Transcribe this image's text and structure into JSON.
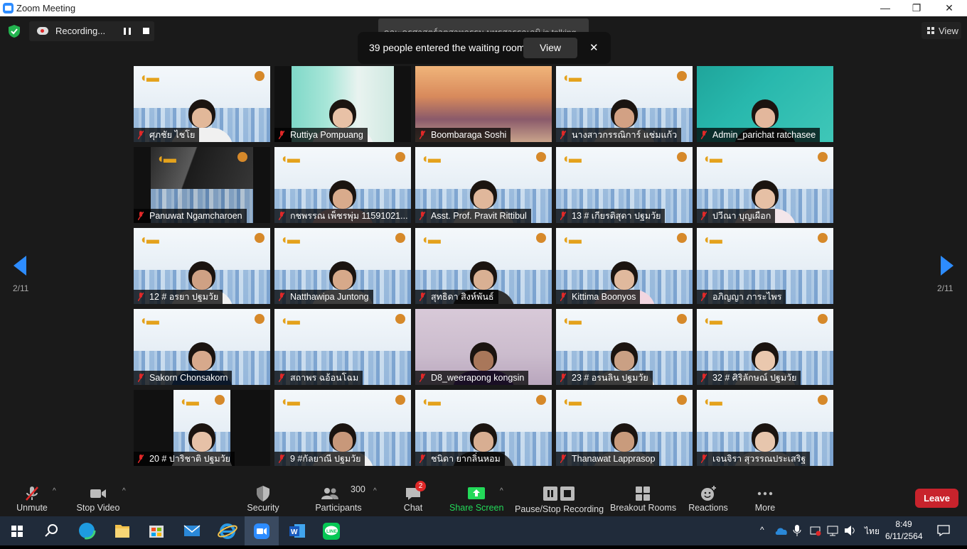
{
  "window": {
    "title": "Zoom Meeting",
    "minimize": "—",
    "maximize": "❐",
    "close": "✕"
  },
  "recording": {
    "label": "Recording..."
  },
  "talking": "คณะครุศาสตร์อุตสาหกรรม มทรสุวรรณภูมิ is talking...",
  "waiting_room": {
    "message": "39 people entered the waiting room",
    "view_label": "View",
    "close": "✕"
  },
  "view_button": "View",
  "pagination": {
    "left": "2/11",
    "right": "2/11"
  },
  "participants": [
    {
      "name": "ศุภชัย ไชโย",
      "cam": "plc",
      "person": true,
      "shirt": "#f0f0f0",
      "skin": "#e2b899"
    },
    {
      "name": "Ruttiya Pompuang",
      "cam": "room",
      "person": true,
      "shirt": "#f2f2f2",
      "skin": "#e8c1a6"
    },
    {
      "name": "Boombaraga Soshi",
      "cam": "street",
      "person": false
    },
    {
      "name": "นางสาวกรรณิการ์  แช่มแก้ว",
      "cam": "plc",
      "person": true,
      "shirt": "#e9e9e9",
      "skin": "#d2a184"
    },
    {
      "name": "Admin_parichat ratchasee",
      "cam": "symposium",
      "person": true,
      "shirt": "#2b2b2b",
      "skin": "#e3b79c"
    },
    {
      "name": "Panuwat Ngamcharoen",
      "cam": "dark",
      "person": false
    },
    {
      "name": "กชพรรณ เพ็ชรพุ่ม 11591021...",
      "cam": "plc",
      "person": true,
      "shirt": "#f5c9c9",
      "skin": "#d9ab8c"
    },
    {
      "name": "Asst. Prof. Pravit Rittibul",
      "cam": "plc",
      "person": true,
      "shirt": "#efefef",
      "skin": "#e0b79b"
    },
    {
      "name": "13 # เกียรติสุดา ปฐมวัย",
      "cam": "plc",
      "person": false
    },
    {
      "name": "ปวีณา บุญเผือก",
      "cam": "plc",
      "person": true,
      "shirt": "#f3e6ea",
      "skin": "#e6c0a5"
    },
    {
      "name": "12 # อรยา ปฐมวัย",
      "cam": "plc",
      "person": true,
      "shirt": "#f0f0f0",
      "skin": "#cfa184"
    },
    {
      "name": "Natthawipa Juntong",
      "cam": "plc",
      "person": true,
      "shirt": "#f1f1f1",
      "skin": "#d7a98a"
    },
    {
      "name": "สุทธิดา สิงห์พันธ์",
      "cam": "plc",
      "person": true,
      "shirt": "#2f2f2f",
      "skin": "#d9b093"
    },
    {
      "name": "Kittima Boonyos",
      "cam": "plc",
      "person": true,
      "shirt": "#f2d6e0",
      "skin": "#e0b99d"
    },
    {
      "name": "อภิญญา ภาระไพร",
      "cam": "plc",
      "person": false
    },
    {
      "name": "Sakorn  Chonsakorn",
      "cam": "plc",
      "person": true,
      "shirt": "#2d5fa6",
      "skin": "#d7a98c"
    },
    {
      "name": "สถาพร ฉอ้อนโฉม",
      "cam": "plc",
      "person": false
    },
    {
      "name": "D8_weerapong  kongsin",
      "cam": "wall",
      "person": true,
      "shirt": "#6a3f95",
      "skin": "#a9775a"
    },
    {
      "name": "23 # อรนลิน ปฐมวัย",
      "cam": "plc",
      "person": true,
      "shirt": "#f0f0f0",
      "skin": "#caa084"
    },
    {
      "name": "32 # ศิริลักษณ์ ปฐมวัย",
      "cam": "plc",
      "person": true,
      "shirt": "#f4f4f4",
      "skin": "#eac8ae"
    },
    {
      "name": "20 # ปาริชาติ ปฐมวัย",
      "cam": "narrow",
      "person": true,
      "shirt": "#f2f2f2",
      "skin": "#e6c1a7"
    },
    {
      "name": "9 #กัลยาณี ปฐมวัย",
      "cam": "plc",
      "person": true,
      "shirt": "#f0f0f0",
      "skin": "#c8987a"
    },
    {
      "name": "ชนิดา ยากลิ่นหอม",
      "cam": "plc",
      "person": true,
      "shirt": "#3a3a3a",
      "skin": "#d8ae92"
    },
    {
      "name": "Thanawat Lapprasop",
      "cam": "plc",
      "person": true,
      "shirt": "#eeeeee",
      "skin": "#c99b7c"
    },
    {
      "name": "เจนจิรา สุวรรณประเสริฐ",
      "cam": "plc",
      "person": true,
      "shirt": "#f2f2f2",
      "skin": "#e7c6ad"
    }
  ],
  "toolbar": {
    "unmute": "Unmute",
    "stop_video": "Stop Video",
    "security": "Security",
    "participants": "Participants",
    "participants_count": "300",
    "chat": "Chat",
    "chat_badge": "2",
    "share_screen": "Share Screen",
    "pause_stop_recording": "Pause/Stop Recording",
    "breakout_rooms": "Breakout Rooms",
    "reactions": "Reactions",
    "more": "More",
    "leave": "Leave"
  },
  "taskbar": {
    "lang": "ไทย",
    "time": "8:49",
    "date": "6/11/2564"
  },
  "colors": {
    "accent": "#2d8cff",
    "leave": "#c8232c",
    "share": "#23d959",
    "muted": "#e02828"
  }
}
